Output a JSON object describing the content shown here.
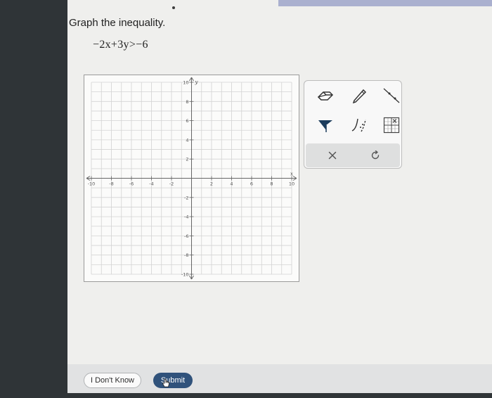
{
  "question": {
    "label": "Graph the inequality.",
    "inequality": "−2x+3y>−6"
  },
  "graph": {
    "x_range": [
      -10,
      10
    ],
    "y_range": [
      -10,
      10
    ],
    "grid_step": 1,
    "tick_step": 2,
    "x_tick_labels": [
      "-10",
      "-8",
      "-6",
      "-4",
      "-2",
      "2",
      "4",
      "6",
      "8",
      "10"
    ],
    "y_tick_labels": [
      "10",
      "8",
      "6",
      "4",
      "2",
      "-2",
      "-4",
      "-6",
      "-8",
      "-10"
    ],
    "x_axis_label": "x",
    "y_axis_label": "y"
  },
  "toolbox": {
    "tools": [
      "eraser-icon",
      "pencil-icon",
      "line-icon",
      "flag-icon",
      "curve-icon",
      "grid-icon"
    ],
    "clear_label": "×",
    "undo_label": "↻"
  },
  "footer": {
    "dont_know_label": "I Don't Know",
    "submit_label": "Submit"
  },
  "colors": {
    "page": "#efefed",
    "graph_bg": "#fbfbfa",
    "grid": "#d3d3d3",
    "axis": "#666666",
    "submit_bg": "#30527b"
  }
}
